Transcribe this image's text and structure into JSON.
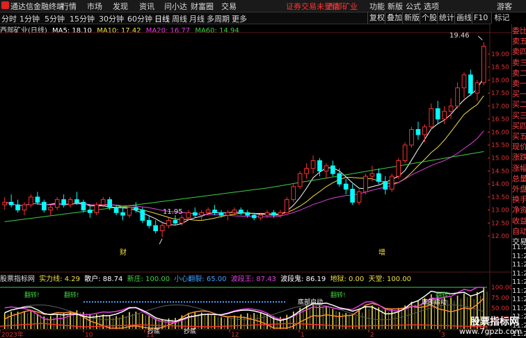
{
  "app": {
    "title": "通达信金融终端",
    "menu": [
      "行情",
      "市场",
      "发现",
      "资讯",
      "问小达",
      "财富圈",
      "交易"
    ],
    "warning": "证券交易未登录",
    "stock_short": "西部矿业",
    "right_menu": [
      "功能",
      "新版",
      "公式",
      "选项"
    ],
    "guest": "游客"
  },
  "toolbar": {
    "periods": [
      "分时",
      "1分钟",
      "5分钟",
      "15分钟",
      "30分钟",
      "60分钟",
      "日线",
      "周线",
      "月线",
      "多周期",
      "更多"
    ],
    "active_period": "日线",
    "right_buttons": [
      "复权",
      "叠加",
      "画线",
      "F10",
      "标记"
    ],
    "right_mid": [
      "新版",
      "个股",
      "统计"
    ]
  },
  "ma": {
    "title": "西部矿业(日线)",
    "items": [
      {
        "label": "MA5: 18.10",
        "color": "#ffffff"
      },
      {
        "label": "MA10: 17.42",
        "color": "#f0e040"
      },
      {
        "label": "MA20: 16.77",
        "color": "#e040e0"
      },
      {
        "label": "MA60: 14.94",
        "color": "#40d040"
      }
    ]
  },
  "annotations": {
    "high": "19.46",
    "low": "11.95",
    "cai": "财",
    "zeng": "增"
  },
  "indicator": {
    "name": "股票指标网",
    "items": [
      {
        "label": "实力线: 4.29",
        "color": "#f0e040"
      },
      {
        "label": "散户: 88.74",
        "color": "#ffffff"
      },
      {
        "label": "新庄: 100.00",
        "color": "#40d040"
      },
      {
        "label": "小心翻裂: 65.00",
        "color": "#40a0ff"
      },
      {
        "label": "波段王: 87.43",
        "color": "#e040e0"
      },
      {
        "label": "波段鬼: 86.19",
        "color": "#ffffff"
      },
      {
        "label": "地狱: 0.00",
        "color": "#f0e040"
      },
      {
        "label": "天堂: 100.00",
        "color": "#f0e040"
      }
    ],
    "signals": [
      "底部启动",
      "底部启动",
      "抄底",
      "抄底"
    ],
    "green_marks": [
      "翻转!",
      "翻转!",
      "翻转!",
      "翻转!",
      "翻转!",
      "翻转!"
    ]
  },
  "x_axis": {
    "labels": [
      "2023年",
      "10",
      "11",
      "12",
      "1",
      "2",
      "3"
    ]
  },
  "right_panel": {
    "red": [
      "委比",
      "卖五",
      "卖四",
      "卖三",
      "卖二",
      "卖一",
      "买一",
      "买二",
      "买三",
      "买四",
      "买五",
      "现价",
      "涨跌",
      "涨幅",
      "总量",
      "外盘",
      "换手",
      "净资",
      "收益",
      "自动"
    ],
    "white_label": "交易",
    "times": [
      "11:2",
      "11:2",
      "11:2",
      "11:2",
      "11:2",
      "11:2",
      "11:2",
      "11:2",
      "11:2",
      "11:2",
      "11:2"
    ]
  },
  "watermark": {
    "line1": "股票指标网",
    "line2": "www.7gpzb.com"
  },
  "colors": {
    "up": "#ff3232",
    "down": "#00ffff",
    "ma5": "#ffffff",
    "ma10": "#f0e040",
    "ma20": "#e040e0",
    "ma60": "#40d040",
    "bg": "#000000"
  },
  "chart_data": {
    "type": "candlestick",
    "title": "西部矿业(日线)",
    "y_ticks": [
      12.0,
      12.5,
      13.0,
      13.5,
      14.0,
      14.5,
      15.0,
      15.5,
      16.0,
      16.5,
      17.0,
      17.5,
      18.0,
      18.5,
      19.0
    ],
    "ylim": [
      11.6,
      19.8
    ],
    "indicator_ticks": [
      100.0,
      75.0,
      50.0,
      25.0
    ],
    "indicator_ylim": [
      0,
      115
    ],
    "ohlc": [
      [
        13.2,
        13.5,
        13.0,
        13.3
      ],
      [
        13.3,
        13.6,
        13.1,
        13.2
      ],
      [
        13.2,
        13.4,
        12.9,
        13.0
      ],
      [
        13.0,
        13.3,
        12.8,
        13.2
      ],
      [
        13.2,
        13.6,
        13.1,
        13.5
      ],
      [
        13.5,
        13.7,
        13.2,
        13.3
      ],
      [
        13.3,
        13.4,
        12.9,
        13.0
      ],
      [
        13.0,
        13.2,
        12.8,
        13.1
      ],
      [
        13.1,
        13.5,
        13.0,
        13.4
      ],
      [
        13.4,
        13.6,
        13.1,
        13.2
      ],
      [
        13.2,
        13.5,
        13.1,
        13.4
      ],
      [
        13.4,
        13.7,
        13.2,
        13.3
      ],
      [
        13.3,
        13.4,
        12.9,
        13.0
      ],
      [
        13.0,
        13.2,
        12.7,
        12.9
      ],
      [
        12.9,
        13.3,
        12.8,
        13.2
      ],
      [
        13.2,
        13.5,
        13.1,
        13.4
      ],
      [
        13.4,
        13.5,
        13.0,
        13.1
      ],
      [
        13.1,
        13.2,
        12.8,
        12.9
      ],
      [
        12.9,
        13.1,
        12.6,
        12.8
      ],
      [
        12.8,
        13.2,
        12.7,
        13.1
      ],
      [
        13.1,
        13.3,
        12.9,
        13.0
      ],
      [
        13.0,
        13.1,
        12.5,
        12.6
      ],
      [
        12.6,
        12.8,
        12.3,
        12.4
      ],
      [
        12.4,
        12.6,
        12.1,
        12.2
      ],
      [
        12.2,
        12.5,
        11.95,
        12.4
      ],
      [
        12.4,
        12.7,
        12.3,
        12.6
      ],
      [
        12.6,
        12.8,
        12.4,
        12.5
      ],
      [
        12.5,
        12.8,
        12.4,
        12.7
      ],
      [
        12.7,
        13.0,
        12.6,
        12.9
      ],
      [
        12.9,
        13.1,
        12.7,
        12.8
      ],
      [
        12.8,
        13.0,
        12.6,
        12.9
      ],
      [
        12.9,
        13.1,
        12.8,
        13.0
      ],
      [
        13.0,
        13.2,
        12.8,
        12.9
      ],
      [
        12.9,
        13.0,
        12.7,
        12.8
      ],
      [
        12.8,
        13.0,
        12.6,
        12.9
      ],
      [
        12.9,
        13.1,
        12.8,
        13.0
      ],
      [
        13.0,
        13.1,
        12.8,
        12.9
      ],
      [
        12.9,
        13.0,
        12.7,
        12.8
      ],
      [
        12.8,
        12.9,
        12.6,
        12.7
      ],
      [
        12.7,
        12.9,
        12.6,
        12.8
      ],
      [
        12.8,
        13.0,
        12.7,
        12.9
      ],
      [
        12.9,
        13.0,
        12.7,
        12.8
      ],
      [
        12.8,
        13.0,
        12.7,
        12.9
      ],
      [
        12.9,
        13.5,
        12.9,
        13.4
      ],
      [
        13.4,
        14.0,
        13.3,
        13.9
      ],
      [
        13.9,
        14.5,
        13.8,
        14.4
      ],
      [
        14.4,
        14.8,
        14.2,
        14.6
      ],
      [
        14.6,
        15.1,
        14.4,
        14.9
      ],
      [
        14.9,
        15.0,
        14.3,
        14.5
      ],
      [
        14.5,
        14.8,
        14.2,
        14.7
      ],
      [
        14.7,
        14.9,
        14.3,
        14.4
      ],
      [
        14.4,
        14.6,
        13.9,
        14.0
      ],
      [
        14.0,
        14.2,
        13.6,
        13.8
      ],
      [
        13.8,
        14.0,
        13.2,
        13.3
      ],
      [
        13.3,
        13.8,
        13.2,
        13.7
      ],
      [
        13.7,
        14.4,
        13.6,
        14.3
      ],
      [
        14.3,
        14.7,
        14.1,
        14.4
      ],
      [
        14.4,
        14.6,
        14.0,
        14.1
      ],
      [
        14.1,
        14.3,
        13.6,
        13.8
      ],
      [
        13.8,
        14.4,
        13.7,
        14.3
      ],
      [
        14.3,
        15.0,
        14.2,
        14.9
      ],
      [
        14.9,
        15.6,
        14.8,
        15.5
      ],
      [
        15.5,
        16.2,
        15.4,
        16.1
      ],
      [
        16.1,
        16.4,
        15.7,
        15.9
      ],
      [
        15.9,
        16.3,
        15.6,
        16.2
      ],
      [
        16.2,
        17.1,
        16.1,
        16.9
      ],
      [
        16.9,
        17.2,
        16.3,
        16.5
      ],
      [
        16.5,
        17.0,
        16.3,
        16.8
      ],
      [
        16.8,
        17.3,
        16.5,
        17.0
      ],
      [
        17.0,
        17.9,
        16.9,
        17.7
      ],
      [
        17.7,
        18.3,
        17.3,
        18.2
      ],
      [
        18.2,
        18.4,
        17.4,
        17.5
      ],
      [
        17.5,
        18.0,
        17.2,
        17.9
      ],
      [
        17.9,
        19.46,
        17.8,
        19.3
      ]
    ]
  }
}
